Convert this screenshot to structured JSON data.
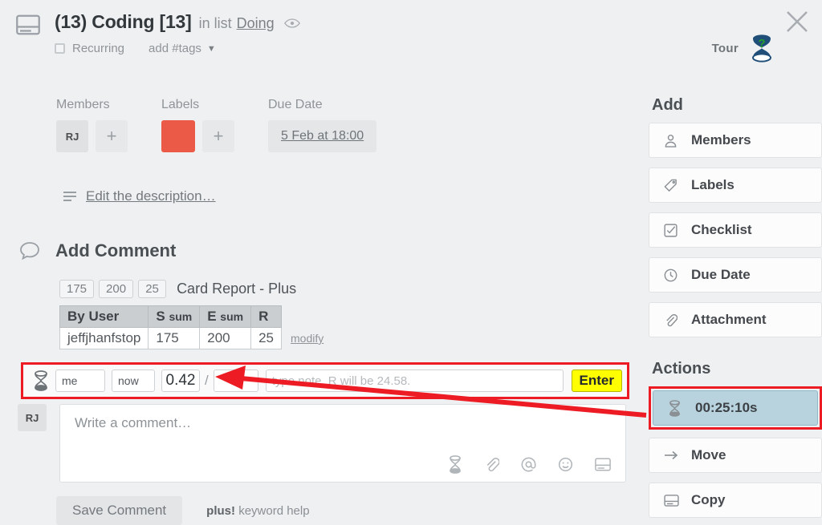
{
  "header": {
    "card_icon": "card-icon",
    "title": "(13) Coding [13]",
    "in_list_text": "in list",
    "list_name": "Doing",
    "watch_icon": "eye-icon",
    "recurring_label": "Recurring",
    "add_tags_label": "add #tags",
    "caret": "▼",
    "tour_label": "Tour",
    "close_icon": "✕"
  },
  "attributes": {
    "members": {
      "label": "Members",
      "avatar": "RJ",
      "add": "+"
    },
    "labels": {
      "label": "Labels",
      "color": "#eb5a46",
      "add": "+"
    },
    "due_date": {
      "label": "Due Date",
      "value": "5 Feb at 18:00"
    }
  },
  "description": {
    "link": "Edit the description…"
  },
  "add_comment": {
    "heading": "Add Comment"
  },
  "report": {
    "badges": [
      "175",
      "200",
      "25"
    ],
    "title": "Card Report - Plus",
    "columns": [
      "By User",
      "S sum",
      "E sum",
      "R"
    ],
    "col_sub": {
      "s": "sum",
      "e": "sum"
    },
    "rows": [
      {
        "user": "jeffjhanfstop",
        "s_sum": "175",
        "e_sum": "200",
        "r": "25"
      }
    ],
    "modify_link": "modify"
  },
  "time_entry": {
    "who_value": "me",
    "when_value": "now",
    "amount_value": "0.42",
    "separator": "/",
    "second_value": "",
    "note_placeholder": "type note, R will be 24.58.",
    "enter_label": "Enter"
  },
  "comment": {
    "avatar": "RJ",
    "placeholder": "Write a comment…",
    "icons": [
      "hourglass-icon",
      "paperclip-icon",
      "mention-icon",
      "emoji-icon",
      "card-icon"
    ],
    "save_label": "Save Comment",
    "keyword_help_bold": "plus!",
    "keyword_help_rest": "keyword help"
  },
  "sidebar": {
    "add_title": "Add",
    "add_items": [
      {
        "label": "Members",
        "icon": "person-icon"
      },
      {
        "label": "Labels",
        "icon": "tag-icon"
      },
      {
        "label": "Checklist",
        "icon": "checkbox-icon"
      },
      {
        "label": "Due Date",
        "icon": "clock-icon"
      },
      {
        "label": "Attachment",
        "icon": "paperclip-icon"
      }
    ],
    "actions_title": "Actions",
    "actions_items": [
      {
        "label": "00:25:10s",
        "icon": "hourglass-icon",
        "highlighted": true
      },
      {
        "label": "Move",
        "icon": "arrow-right-icon",
        "highlighted": false
      },
      {
        "label": "Copy",
        "icon": "card-icon",
        "highlighted": false
      }
    ]
  },
  "annotation": {
    "arrow_color": "#ed1c24"
  }
}
